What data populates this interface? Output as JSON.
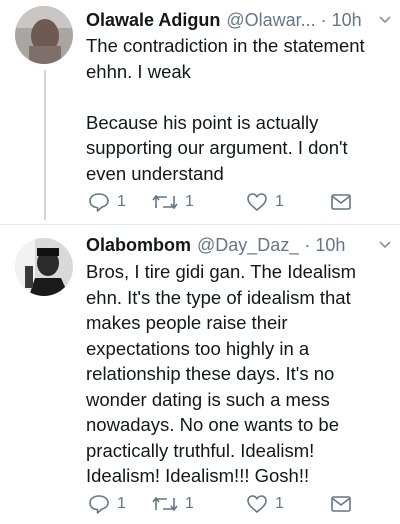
{
  "tweets": [
    {
      "name": "Olawale Adigun",
      "handle": "@Olawar...",
      "separator": "·",
      "time": "10h",
      "text_lines": [
        "The contradiction in the statement",
        "ehhn. I weak",
        "",
        "Because his point is actually",
        "supporting our argument. I don't",
        "even understand"
      ],
      "replies": "1",
      "retweets": "1",
      "likes": "1",
      "icons": [
        "reply-icon",
        "retweet-icon",
        "like-icon",
        "direct-message-icon",
        "chevron-down-icon"
      ]
    },
    {
      "name": "Olabombom",
      "handle": "@Day_Daz_",
      "separator": "·",
      "time": "10h",
      "text_lines": [
        "Bros, I tire gidi gan. The Idealism",
        "ehn. It's the type of idealism that",
        "makes people raise their",
        "expectations too highly in a",
        "relationship these days. It's no",
        "wonder dating is such a mess",
        "nowadays. No one wants to be",
        "practically truthful. Idealism!",
        "Idealism! Idealism!!! Gosh!!"
      ],
      "replies": "1",
      "retweets": "1",
      "likes": "1",
      "icons": [
        "reply-icon",
        "retweet-icon",
        "like-icon",
        "direct-message-icon",
        "chevron-down-icon"
      ]
    }
  ],
  "colors": {
    "text": "#14171a",
    "secondary": "#657786",
    "thread_line": "#ccd6dd",
    "divider": "#e1e8ed"
  }
}
